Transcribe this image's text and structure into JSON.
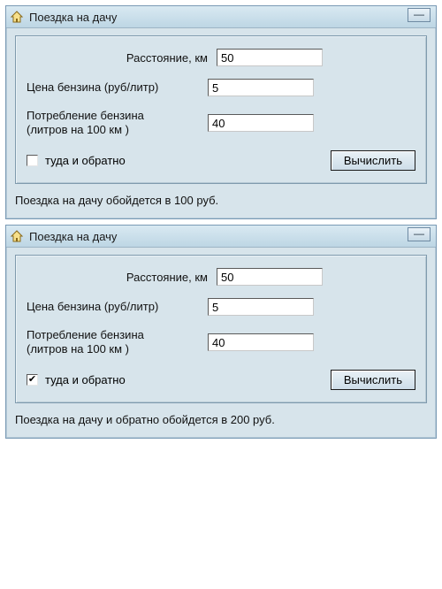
{
  "windows": [
    {
      "title": "Поездка на дачу",
      "minimize": "—",
      "labels": {
        "distance": "Расстояние, км",
        "price": "Цена бензина (руб/литр)",
        "consumption_line1": "Потребление бензина",
        "consumption_line2": "(литров на 100 км )",
        "roundtrip": "туда и обратно",
        "calc": "Вычислить"
      },
      "values": {
        "distance": "50",
        "price": "5",
        "consumption": "40",
        "roundtrip_checked": false
      },
      "result": "Поездка на дачу  обойдется в 100 руб."
    },
    {
      "title": "Поездка на дачу",
      "minimize": "—",
      "labels": {
        "distance": "Расстояние, км",
        "price": "Цена бензина (руб/литр)",
        "consumption_line1": "Потребление бензина",
        "consumption_line2": "(литров на 100 км )",
        "roundtrip": "туда и обратно",
        "calc": "Вычислить"
      },
      "values": {
        "distance": "50",
        "price": "5",
        "consumption": "40",
        "roundtrip_checked": true
      },
      "result": "Поездка на дачу  и обратно  обойдется в 200 руб."
    }
  ],
  "check_glyph": "✔"
}
